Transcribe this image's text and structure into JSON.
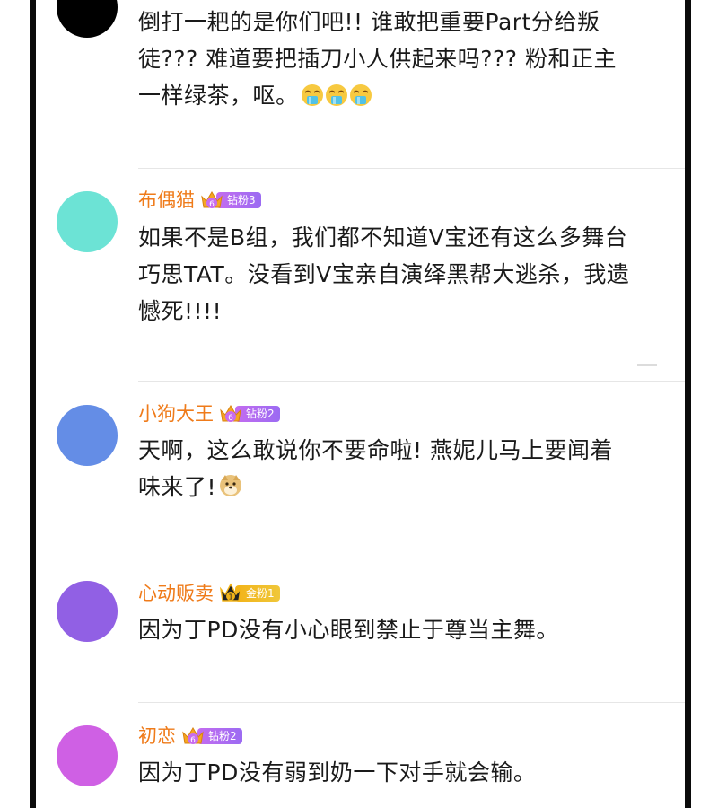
{
  "comments": [
    {
      "text_lines": [
        "倒打一耙的是你们吧!! 谁敢把重要Part分给叛",
        "徒??? 难道要把插刀小人供起来吗??? 粉和正主",
        "一样绿茶，呕。"
      ],
      "emoji": "vomit-emoji",
      "avatar_color": "#000000"
    },
    {
      "username": "布偶猫",
      "badge_label": "钻粉3",
      "crown_level": "6",
      "text_lines": [
        "如果不是B组，我们都不知道V宝还有这么多舞台",
        "巧思TAT。没看到V宝亲自演绎黑帮大逃杀，我遗",
        "憾死!!!!"
      ],
      "avatar_color": "#6ce3d5"
    },
    {
      "username": "小狗大王",
      "badge_label": "钻粉2",
      "crown_level": "6",
      "text_lines": [
        "天啊，这么敢说你不要命啦! 燕妮儿马上要闻着",
        "味来了!"
      ],
      "emoji": "doge-emoji",
      "avatar_color": "#648de6"
    },
    {
      "username": "心动贩卖",
      "badge_label": "金粉1",
      "crown_level": "1",
      "text_lines": [
        "因为丁PD没有小心眼到禁止于尊当主舞。"
      ],
      "avatar_color": "#9160e4"
    },
    {
      "username": "初恋",
      "badge_label": "钻粉2",
      "crown_level": "6",
      "text_lines": [
        "因为丁PD没有弱到奶一下对手就会输。"
      ],
      "avatar_color": "#cf60e4"
    }
  ],
  "colors": {
    "username": "#ef7b1a",
    "diamond_badge": "#b56cf1",
    "gold_badge": "#f2b318"
  }
}
